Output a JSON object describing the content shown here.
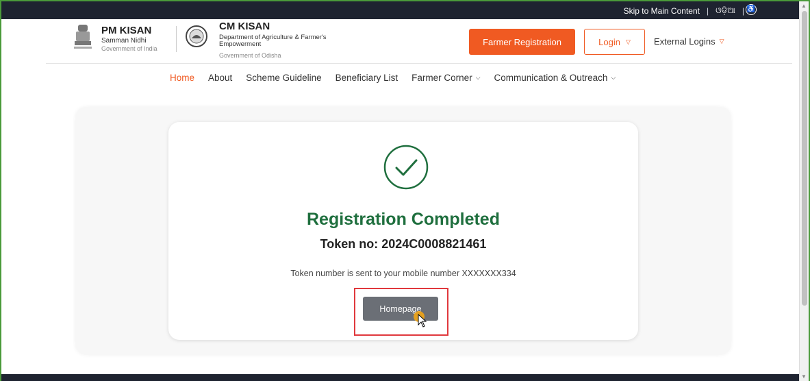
{
  "topbar": {
    "skip": "Skip to Main Content",
    "language": "ଓଡ଼ିଆ",
    "accessibility_icon": "accessibility-icon"
  },
  "brand": {
    "pm_title": "PM KISAN",
    "pm_sub": "Samman Nidhi",
    "pm_gov": "Government of India",
    "cm_title": "CM KISAN",
    "cm_dept": "Department of Agriculture & Farmer's Empowerment",
    "cm_gov": "Government of Odisha"
  },
  "header_actions": {
    "register": "Farmer Registration",
    "login": "Login",
    "external": "External Logins"
  },
  "nav": {
    "items": [
      {
        "label": "Home",
        "active": true
      },
      {
        "label": "About"
      },
      {
        "label": "Scheme Guideline"
      },
      {
        "label": "Beneficiary List"
      },
      {
        "label": "Farmer Corner",
        "dropdown": true
      },
      {
        "label": "Communication & Outreach",
        "dropdown": true
      }
    ]
  },
  "result": {
    "title": "Registration Completed",
    "token": "Token no: 2024C0008821461",
    "message": "Token number is sent to your mobile number XXXXXXX334",
    "home_button": "Homepage"
  },
  "colors": {
    "accent": "#f05a22",
    "success": "#1f6f3e",
    "highlight": "#e0383c",
    "dark": "#1e2330"
  }
}
